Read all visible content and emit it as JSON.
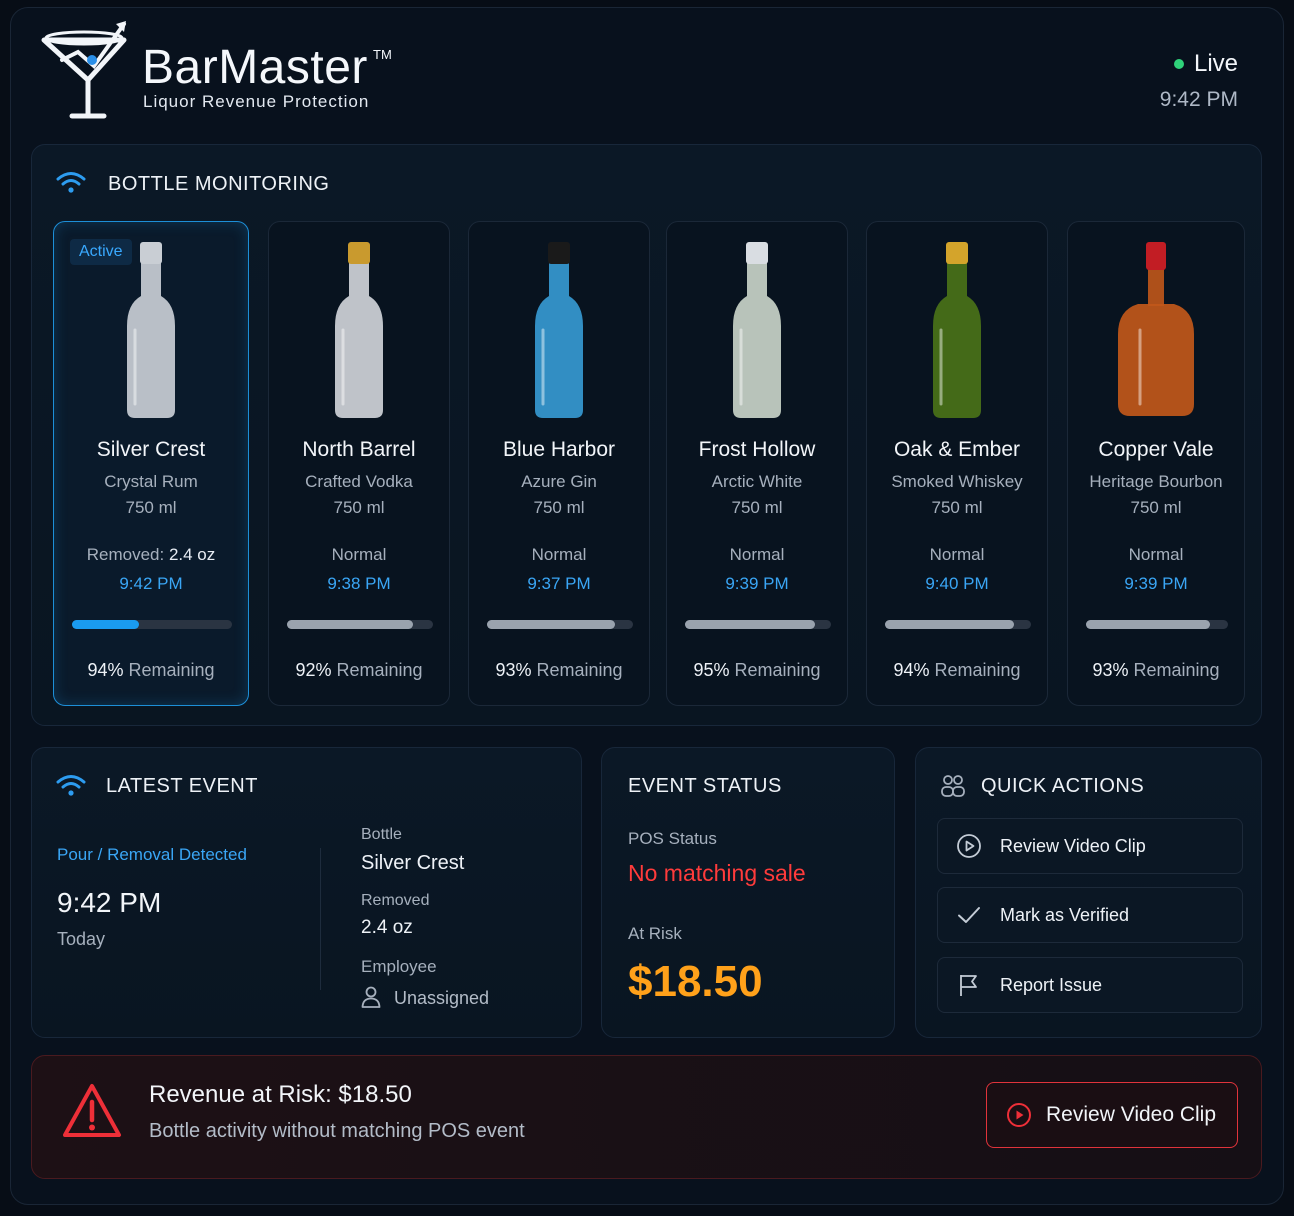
{
  "header": {
    "brand_name": "BarMaster",
    "brand_tm": "TM",
    "brand_tagline": "Liquor Revenue Protection",
    "live_label": "Live",
    "time": "9:42 PM"
  },
  "monitoring": {
    "title": "BOTTLE MONITORING",
    "active_badge": "Active",
    "remaining_suffix": "Remaining",
    "bottles": [
      {
        "name": "Silver Crest",
        "type": "Crystal Rum",
        "size": "750 ml",
        "status_prefix": "Removed: ",
        "status_value": "2.4 oz",
        "time": "9:42 PM",
        "percent": "94%",
        "level": 0.94,
        "color": "#d8dde3",
        "cap": "#c9ced4",
        "active": true
      },
      {
        "name": "North Barrel",
        "type": "Crafted Vodka",
        "size": "750 ml",
        "status_prefix": "Normal",
        "status_value": "",
        "time": "9:38 PM",
        "percent": "92%",
        "level": 0.92,
        "color": "#dfe3e8",
        "cap": "#c99a2e",
        "active": false
      },
      {
        "name": "Blue Harbor",
        "type": "Azure Gin",
        "size": "750 ml",
        "status_prefix": "Normal",
        "status_value": "",
        "time": "9:37 PM",
        "percent": "93%",
        "level": 0.93,
        "color": "#3aa5e0",
        "cap": "#1a1a1a",
        "active": false
      },
      {
        "name": "Frost Hollow",
        "type": "Arctic White",
        "size": "750 ml",
        "status_prefix": "Normal",
        "status_value": "",
        "time": "9:39 PM",
        "percent": "95%",
        "level": 0.95,
        "color": "#d7e3d6",
        "cap": "#d9dde2",
        "active": false
      },
      {
        "name": "Oak & Ember",
        "type": "Smoked Whiskey",
        "size": "750 ml",
        "status_prefix": "Normal",
        "status_value": "",
        "time": "9:40 PM",
        "percent": "94%",
        "level": 0.94,
        "color": "#4f7a17",
        "cap": "#d4a42b",
        "active": false
      },
      {
        "name": "Copper Vale",
        "type": "Heritage Bourbon",
        "size": "750 ml",
        "status_prefix": "Normal",
        "status_value": "",
        "time": "9:39 PM",
        "percent": "93%",
        "level": 0.93,
        "color": "#c1581a",
        "cap": "#c21d24",
        "active": false
      }
    ]
  },
  "latest_event": {
    "title": "LATEST EVENT",
    "event_label": "Pour / Removal Detected",
    "event_time": "9:42 PM",
    "event_day": "Today",
    "bottle_key": "Bottle",
    "bottle_value": "Silver Crest",
    "removed_key": "Removed",
    "removed_value": "2.4 oz",
    "employee_key": "Employee",
    "employee_value": "Unassigned"
  },
  "event_status": {
    "title": "EVENT STATUS",
    "pos_key": "POS Status",
    "pos_value": "No matching sale",
    "risk_key": "At Risk",
    "risk_value": "$18.50"
  },
  "quick_actions": {
    "title": "QUICK ACTIONS",
    "review": "Review Video Clip",
    "verify": "Mark as Verified",
    "report": "Report Issue"
  },
  "alert": {
    "title": "Revenue at Risk: $18.50",
    "subtitle": "Bottle activity without matching POS event",
    "button": "Review Video Clip"
  },
  "colors": {
    "accent": "#3aa6f5",
    "danger": "#ff3b3b",
    "amount": "#ffa11a",
    "live": "#2fd27a"
  }
}
